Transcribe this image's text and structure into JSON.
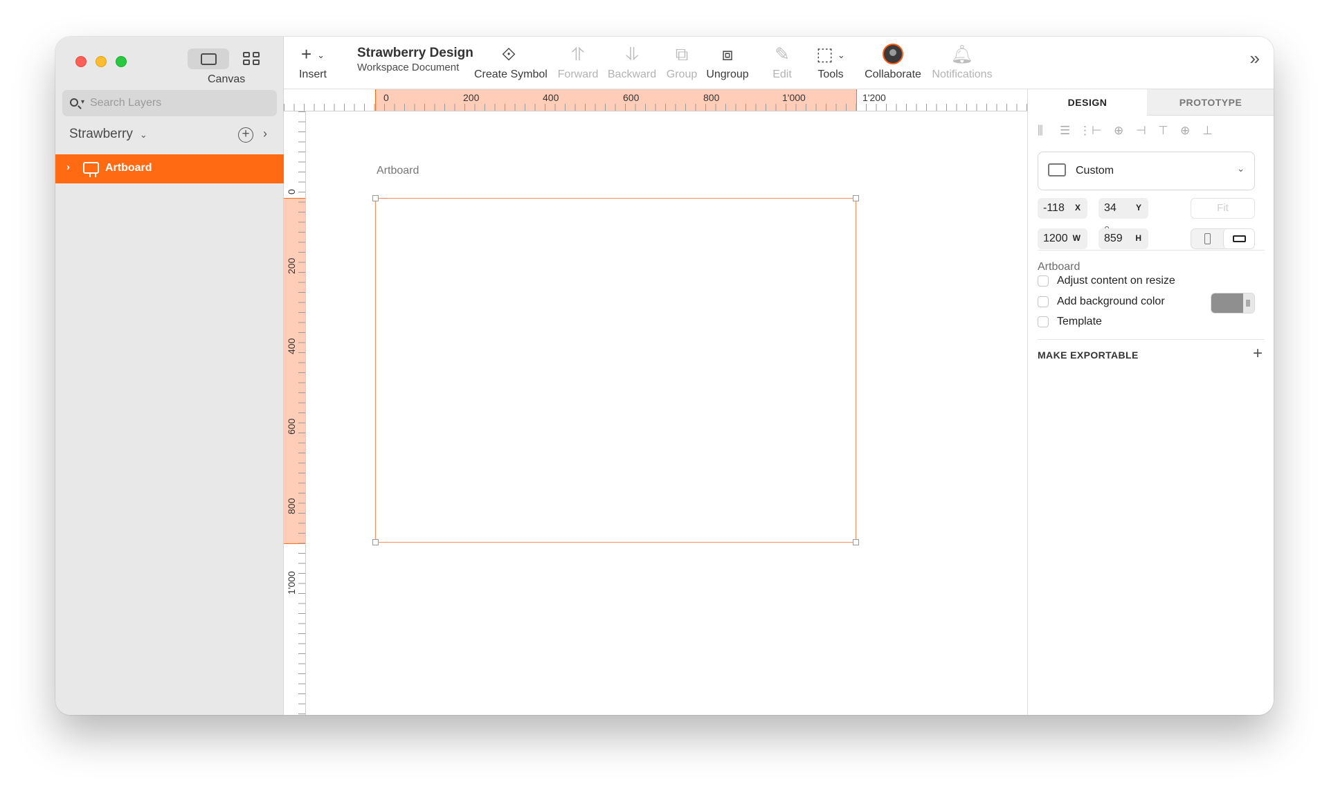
{
  "window": {
    "sidebar": {
      "canvas_label": "Canvas",
      "search_placeholder": "Search Layers",
      "page_name": "Strawberry",
      "layers": [
        {
          "label": "Artboard",
          "selected": true
        }
      ]
    },
    "toolbar": {
      "insert_label": "Insert",
      "doc_title": "Strawberry Design",
      "doc_subtitle": "Workspace Document",
      "buttons": {
        "create_symbol": "Create Symbol",
        "forward": "Forward",
        "backward": "Backward",
        "group": "Group",
        "ungroup": "Ungroup",
        "edit": "Edit",
        "tools": "Tools",
        "collaborate": "Collaborate",
        "notifications": "Notifications"
      }
    },
    "rulers": {
      "horizontal": [
        "0",
        "200",
        "400",
        "600",
        "800",
        "1'000",
        "1'200"
      ],
      "vertical": [
        "0",
        "200",
        "400",
        "600",
        "800",
        "1'000"
      ]
    },
    "canvas": {
      "artboard_title": "Artboard"
    },
    "inspector": {
      "tabs": [
        "DESIGN",
        "PROTOTYPE"
      ],
      "preset": "Custom",
      "x": "-118",
      "x_key": "X",
      "y": "34",
      "y_key": "Y",
      "w": "1200",
      "w_key": "W",
      "h": "859",
      "h_key": "H",
      "fit": "Fit",
      "section_title": "Artboard",
      "options": [
        "Adjust content on resize",
        "Add background color",
        "Template"
      ],
      "background_color": "#8f8f8f",
      "export_title": "MAKE EXPORTABLE"
    },
    "colors": {
      "accent": "#ff6a12",
      "ruler_highlight": "#ffcdb8"
    }
  }
}
